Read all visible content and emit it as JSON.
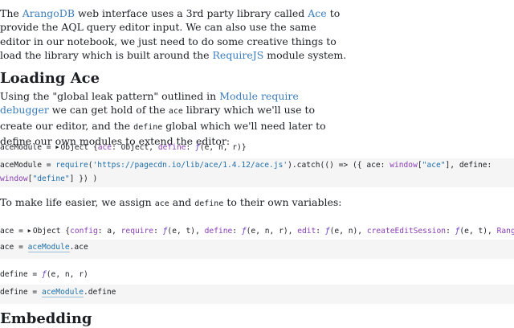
{
  "intro": {
    "t1": "The ",
    "link_arangodb": "ArangoDB",
    "t2": " web interface uses a 3rd party library called ",
    "link_ace": "Ace",
    "t3": " to provide the AQL query editor input. We can also use the same editor in our notebook, we just need to do some creative things to load the library which is built around the ",
    "link_requirejs": "RequireJS",
    "t4": " module system."
  },
  "heading_loading": "Loading Ace",
  "p2": {
    "t1": "Using the \"global leak pattern\" outlined in ",
    "link": "Module require debugger",
    "t2": " we can get hold of the ",
    "code1": "ace",
    "t3": " library which we'll use to create our editor, and the ",
    "code2": "define",
    "t4": " global which we'll need later to define our own modules to extend the editor:"
  },
  "cell1_out": {
    "name": "aceModule",
    "eq": " = ",
    "triangle": "▶",
    "type": "Object",
    "open": " {",
    "key1": "ace",
    "val1": ": Object, ",
    "key2": "define",
    "colon": ": ",
    "fsym": "ƒ",
    "sig": "(e, n, r)",
    "close": "}"
  },
  "cell1_src": {
    "name": "aceModule",
    "eq": " = ",
    "fn": "require",
    "p1": "(",
    "url": "'https://pagecdn.io/lib/ace/1.4.12/ace.js'",
    "p2": ").catch(() => ({ ace: ",
    "win1": "window",
    "b1": "[",
    "str1": "\"ace\"",
    "b2": "], define:",
    "win2": "window",
    "b3": "[",
    "str2": "\"define\"",
    "b4": "] }) )"
  },
  "p3": {
    "t1": "To make life easier, we assign ",
    "code1": "ace",
    "t2": " and ",
    "code2": "define",
    "t3": " to their own variables:"
  },
  "cell2_out": {
    "name": "ace",
    "eq": " = ",
    "triangle": "▶",
    "type": "Object",
    "open": " {",
    "k1": "config",
    "v1": ": a, ",
    "k2": "require",
    "v2": "(e, t), ",
    "k3": "define",
    "v3": "(e, n, r), ",
    "k4": "edit",
    "v4": "(e, n), ",
    "k5": "createEditSession",
    "v5": "(e, t), ",
    "k6": "Range",
    "colon": ": ",
    "fsym": "ƒ"
  },
  "cell2_src": {
    "name": "ace",
    "eq": " = ",
    "ref": "aceModule",
    "prop": ".ace"
  },
  "cell3_out": {
    "name": "define",
    "eq": " = ",
    "fsym": "ƒ",
    "sig": "(e, n, r)"
  },
  "cell3_src": {
    "name": "define",
    "eq": " = ",
    "ref": "aceModule",
    "prop": ".define"
  },
  "heading_embedding": "Embedding"
}
